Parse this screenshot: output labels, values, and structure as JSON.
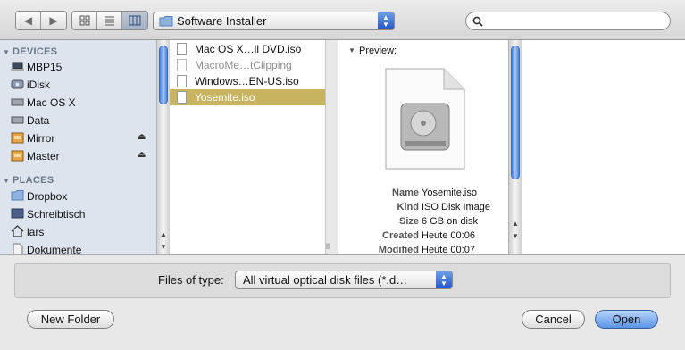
{
  "toolbar": {
    "location": "Software Installer",
    "search_placeholder": ""
  },
  "sidebar": {
    "sections": [
      {
        "title": "DEVICES",
        "items": [
          {
            "label": "MBP15",
            "icon": "laptop-icon"
          },
          {
            "label": "iDisk",
            "icon": "idisk-icon"
          },
          {
            "label": "Mac OS X",
            "icon": "hard-drive-icon"
          },
          {
            "label": "Data",
            "icon": "hard-drive-icon"
          },
          {
            "label": "Mirror",
            "icon": "external-drive-icon",
            "eject": true
          },
          {
            "label": "Master",
            "icon": "external-drive-icon",
            "eject": true
          }
        ]
      },
      {
        "title": "PLACES",
        "items": [
          {
            "label": "Dropbox",
            "icon": "folder-icon"
          },
          {
            "label": "Schreibtisch",
            "icon": "desktop-icon"
          },
          {
            "label": "lars",
            "icon": "home-icon"
          },
          {
            "label": "Dokumente",
            "icon": "document-icon"
          }
        ]
      }
    ]
  },
  "files": [
    {
      "name": "Mac OS X…ll DVD.iso",
      "state": "normal"
    },
    {
      "name": "MacroMe…tClipping",
      "state": "dim"
    },
    {
      "name": "Windows…EN-US.iso",
      "state": "normal"
    },
    {
      "name": "Yosemite.iso",
      "state": "selected"
    }
  ],
  "preview": {
    "label": "Preview:",
    "name_key": "Name",
    "name_val": "Yosemite.iso",
    "kind_key": "Kind",
    "kind_val": "ISO Disk Image",
    "size_key": "Size",
    "size_val": "6 GB on disk",
    "created_key": "Created",
    "created_val": "Heute 00:06",
    "modified_key": "Modified",
    "modified_val": "Heute 00:07"
  },
  "filter": {
    "label": "Files of type:",
    "value": "All virtual optical disk files (*.d…"
  },
  "buttons": {
    "new_folder": "New Folder",
    "cancel": "Cancel",
    "open": "Open"
  },
  "colors": {
    "selection": "#c8b361",
    "sidebar_bg": "#dde4ee",
    "accent": "#2457c7"
  }
}
